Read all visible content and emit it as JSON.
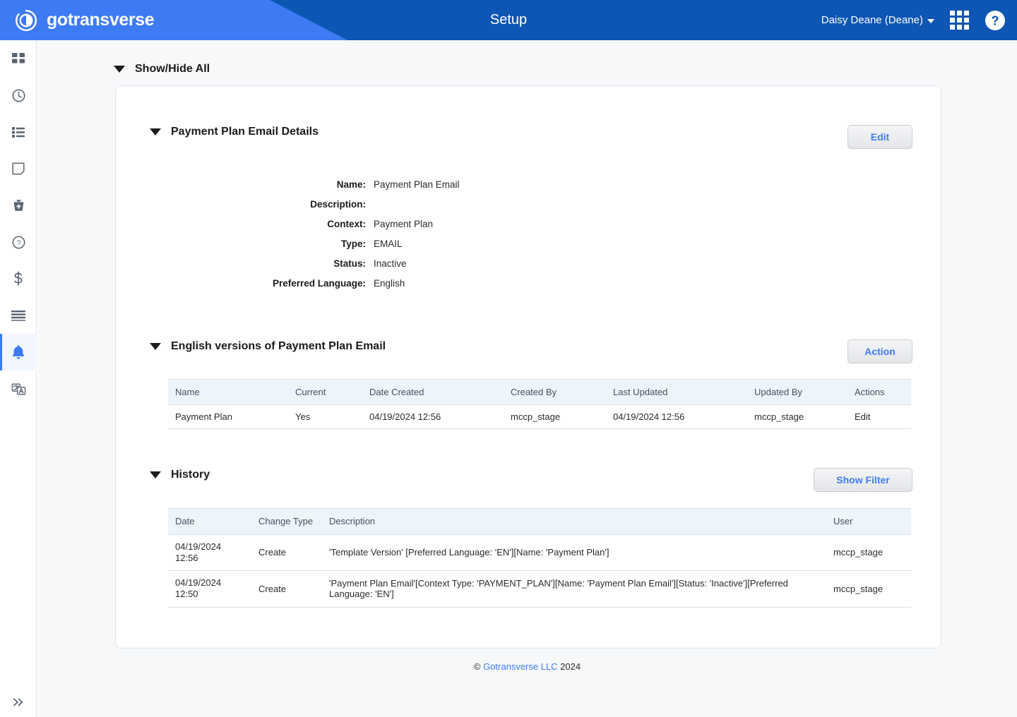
{
  "header": {
    "brand": "gotransverse",
    "brand_logo_icon": "gotransverse-circle-logo",
    "title": "Setup",
    "user_menu": "Daisy Deane (Deane)",
    "apps_icon": "grid-apps-icon",
    "help_icon": "help-circle-icon",
    "bg_color": "#0d56b3",
    "accent_color": "#3d7bf4"
  },
  "sidebar": {
    "items": [
      {
        "icon": "dashboard-icon",
        "name": "sidebar-item-dashboard",
        "active": false
      },
      {
        "icon": "clock-icon",
        "name": "sidebar-item-recent",
        "active": false
      },
      {
        "icon": "list-icon",
        "name": "sidebar-item-list",
        "active": false
      },
      {
        "icon": "note-icon",
        "name": "sidebar-item-notes",
        "active": false
      },
      {
        "icon": "bag-icon",
        "name": "sidebar-item-products",
        "active": false
      },
      {
        "icon": "question-circle-icon",
        "name": "sidebar-item-support",
        "active": false
      },
      {
        "icon": "dollar-icon",
        "name": "sidebar-item-billing",
        "active": false
      },
      {
        "icon": "menu-lines-icon",
        "name": "sidebar-item-reports",
        "active": false
      },
      {
        "icon": "bell-icon",
        "name": "sidebar-item-notifications",
        "active": true
      },
      {
        "icon": "translate-icon",
        "name": "sidebar-item-localization",
        "active": false
      }
    ],
    "expand_icon": "chevron-double-right-icon"
  },
  "main": {
    "show_hide_all": "Show/Hide All",
    "details": {
      "title": "Payment Plan Email Details",
      "edit_label": "Edit",
      "fields": [
        {
          "label": "Name:",
          "value": "Payment Plan Email"
        },
        {
          "label": "Description:",
          "value": ""
        },
        {
          "label": "Context:",
          "value": "Payment Plan"
        },
        {
          "label": "Type:",
          "value": "EMAIL"
        },
        {
          "label": "Status:",
          "value": "Inactive"
        },
        {
          "label": "Preferred Language:",
          "value": "English"
        }
      ]
    },
    "versions": {
      "title": "English versions of Payment Plan Email",
      "action_label": "Action",
      "columns": [
        "Name",
        "Current",
        "Date Created",
        "Created By",
        "Last Updated",
        "Updated By",
        "Actions"
      ],
      "rows": [
        {
          "name": "Payment Plan",
          "current": "Yes",
          "date_created": "04/19/2024 12:56",
          "created_by": "mccp_stage",
          "last_updated": "04/19/2024 12:56",
          "updated_by": "mccp_stage",
          "action": "Edit"
        }
      ]
    },
    "history": {
      "title": "History",
      "show_filter_label": "Show Filter",
      "columns": [
        "Date",
        "Change Type",
        "Description",
        "User"
      ],
      "rows": [
        {
          "date": "04/19/2024\n12:56",
          "change_type": "Create",
          "description": "'Template Version' [Preferred Language: 'EN'][Name: 'Payment Plan']",
          "user": "mccp_stage"
        },
        {
          "date": "04/19/2024\n12:50",
          "change_type": "Create",
          "description": "'Payment Plan Email'[Context Type: 'PAYMENT_PLAN'][Name: 'Payment Plan Email'][Status: 'Inactive'][Preferred Language: 'EN']",
          "user": "mccp_stage"
        }
      ]
    }
  },
  "footer": {
    "copyright_symbol": "©",
    "company": "Gotransverse LLC",
    "year": "2024"
  }
}
